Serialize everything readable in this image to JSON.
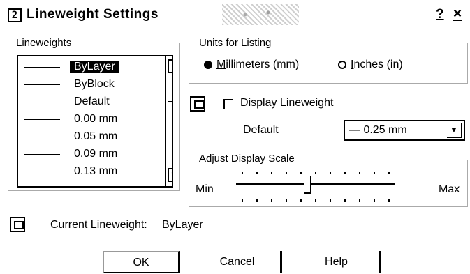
{
  "window": {
    "title": "Lineweight Settings",
    "help_label": "?",
    "close_label": "×"
  },
  "lineweights": {
    "legend": "Lineweights",
    "items": [
      {
        "label": "ByLayer",
        "selected": true
      },
      {
        "label": "ByBlock",
        "selected": false
      },
      {
        "label": "Default",
        "selected": false
      },
      {
        "label": "0.00 mm",
        "selected": false
      },
      {
        "label": "0.05 mm",
        "selected": false
      },
      {
        "label": "0.09 mm",
        "selected": false
      },
      {
        "label": "0.13 mm",
        "selected": false
      }
    ]
  },
  "units": {
    "legend": "Units for Listing",
    "millimeters": {
      "label": "illimeters (mm)",
      "mnemonic": "M",
      "selected": true
    },
    "inches": {
      "label": "nches (in)",
      "mnemonic": "I",
      "selected": false
    }
  },
  "display": {
    "checkbox_mnemonic": "D",
    "checkbox_label": "isplay Lineweight",
    "checked": false,
    "default_label": "Default",
    "default_value": "— 0.25 mm"
  },
  "scale": {
    "legend": "Adjust Display Scale",
    "min_label": "Min",
    "max_label": "Max",
    "level": 0.45
  },
  "current": {
    "label": "Current Lineweight:",
    "value": "ByLayer"
  },
  "buttons": {
    "ok": "OK",
    "cancel": "Cancel",
    "help_mnemonic": "H",
    "help_rest": "elp"
  },
  "icons": {
    "title": "app-window-icon",
    "pc": "monitor-icon"
  }
}
